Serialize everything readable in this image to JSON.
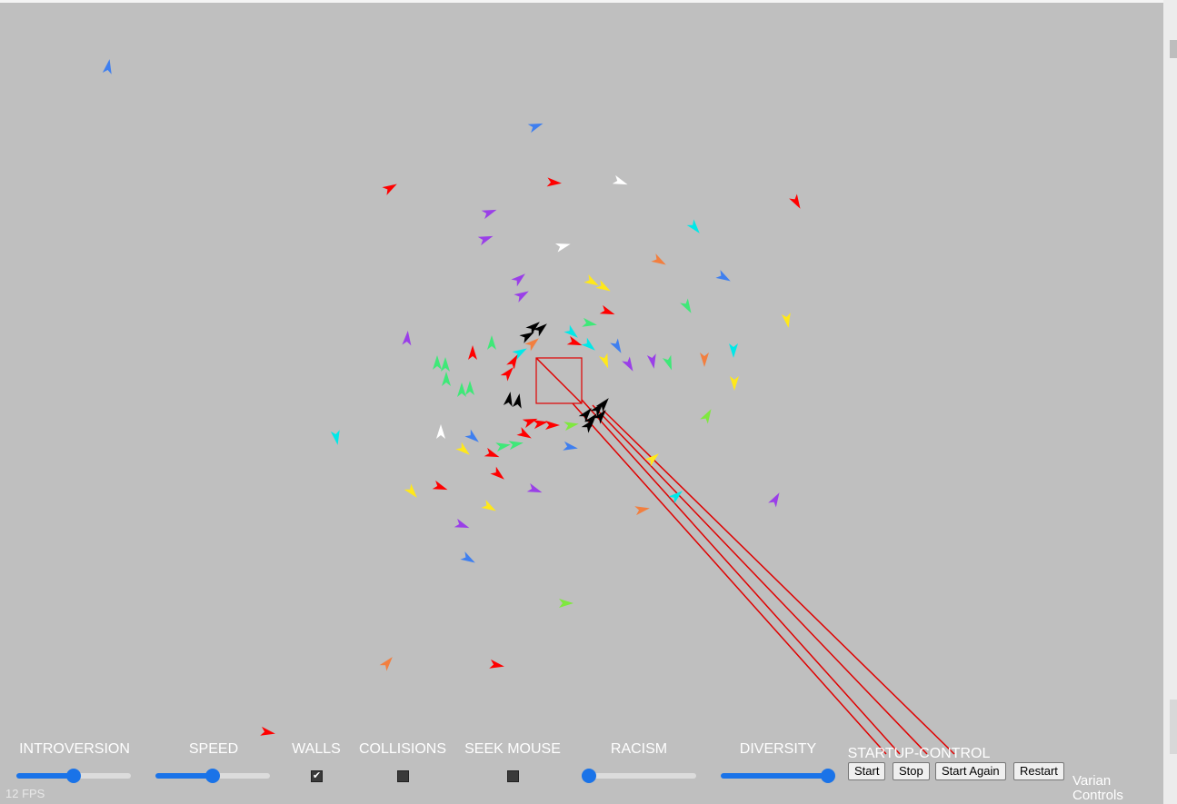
{
  "controls": {
    "introversion": {
      "label": "INTROVERSION",
      "value": 0.5
    },
    "speed": {
      "label": "SPEED",
      "value": 0.5
    },
    "walls": {
      "label": "WALLS",
      "checked": true
    },
    "collisions": {
      "label": "COLLISIONS",
      "checked": false
    },
    "seek_mouse": {
      "label": "SEEK MOUSE",
      "checked": false
    },
    "racism": {
      "label": "RACISM",
      "value": 0.0
    },
    "diversity": {
      "label": "DIVERSITY",
      "value": 1.0
    },
    "startup": {
      "label": "STARTUP-CONTROL",
      "buttons": [
        "Start",
        "Stop",
        "Start Again",
        "Restart"
      ]
    }
  },
  "fps": "12 FPS",
  "varian_label": "Varian\nControls",
  "colors": {
    "background": "#bfbfbf",
    "accent": "#1a73e8",
    "target": "#e00000",
    "boid_palette": [
      "#ff0000",
      "#3f7fef",
      "#9a3fe8",
      "#00e8e8",
      "#3fe878",
      "#7fe83f",
      "#ffe81a",
      "#f27f3f",
      "#ffffff",
      "#000000"
    ]
  },
  "icons": {
    "check": "check-icon"
  }
}
